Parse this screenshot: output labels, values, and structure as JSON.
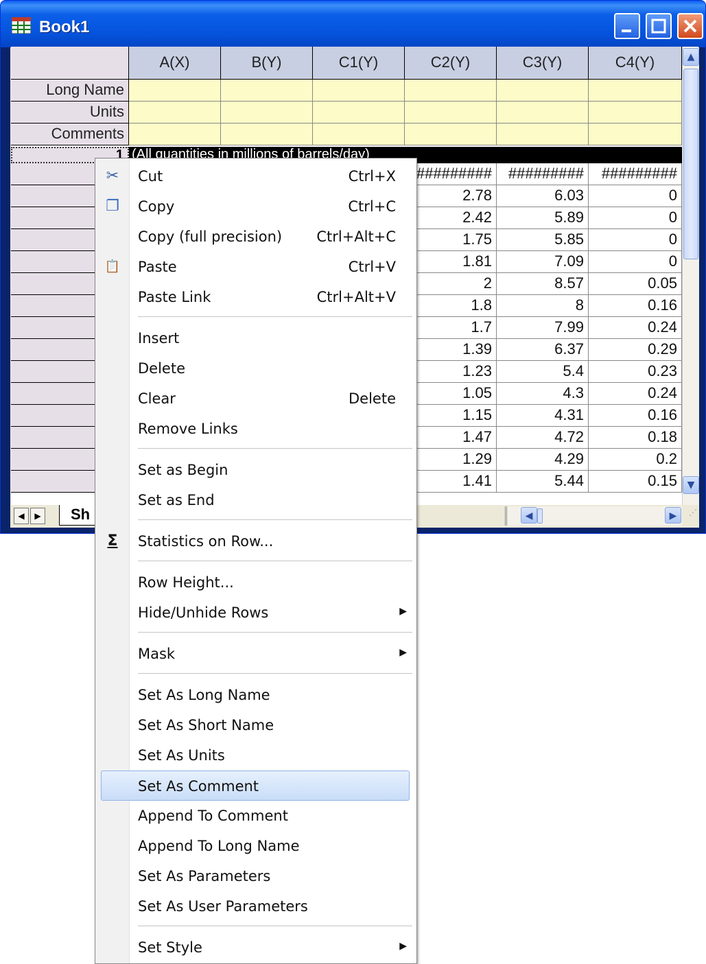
{
  "window": {
    "title": "Book1",
    "colors": {
      "titlebar": "#0553dc",
      "header": "#c8cfe2",
      "meta_row": "#fdfcc8",
      "highlight": "#c9ddf8"
    }
  },
  "grid": {
    "columns": [
      "A(X)",
      "B(Y)",
      "C1(Y)",
      "C2(Y)",
      "C3(Y)",
      "C4(Y)"
    ],
    "meta_rows": [
      "Long Name",
      "Units",
      "Comments"
    ],
    "row1": {
      "number": "1",
      "comment": "(All quantities in millions of barrels/day)"
    },
    "overflow_row": [
      "#########",
      "#########",
      "#########"
    ],
    "data_rows": [
      [
        "2.78",
        "6.03",
        "0"
      ],
      [
        "2.42",
        "5.89",
        "0"
      ],
      [
        "1.75",
        "5.85",
        "0"
      ],
      [
        "1.81",
        "7.09",
        "0"
      ],
      [
        "2",
        "8.57",
        "0.05"
      ],
      [
        "1.8",
        "8",
        "0.16"
      ],
      [
        "1.7",
        "7.99",
        "0.24"
      ],
      [
        "1.39",
        "6.37",
        "0.29"
      ],
      [
        "1.23",
        "5.4",
        "0.23"
      ],
      [
        "1.05",
        "4.3",
        "0.24"
      ],
      [
        "1.15",
        "4.31",
        "0.16"
      ],
      [
        "1.47",
        "4.72",
        "0.18"
      ],
      [
        "1.29",
        "4.29",
        "0.2"
      ],
      [
        "1.41",
        "5.44",
        "0.15"
      ]
    ],
    "sheet_tab": "Sh"
  },
  "menu": {
    "items": [
      {
        "label": "Cut",
        "shortcut": "Ctrl+X",
        "icon": "scissors-icon"
      },
      {
        "label": "Copy",
        "shortcut": "Ctrl+C",
        "icon": "copy-icon"
      },
      {
        "label": "Copy (full precision)",
        "shortcut": "Ctrl+Alt+C"
      },
      {
        "label": "Paste",
        "shortcut": "Ctrl+V",
        "icon": "paste-icon"
      },
      {
        "label": "Paste Link",
        "shortcut": "Ctrl+Alt+V"
      },
      {
        "label": "Insert"
      },
      {
        "label": "Delete"
      },
      {
        "label": "Clear",
        "shortcut": "Delete"
      },
      {
        "label": "Remove Links"
      },
      {
        "label": "Set as Begin"
      },
      {
        "label": "Set as End"
      },
      {
        "label": "Statistics on Row...",
        "icon": "sigma-icon"
      },
      {
        "label": "Row Height..."
      },
      {
        "label": "Hide/Unhide Rows",
        "submenu": true
      },
      {
        "label": "Mask",
        "submenu": true
      },
      {
        "label": "Set As Long Name"
      },
      {
        "label": "Set As Short Name"
      },
      {
        "label": "Set As Units"
      },
      {
        "label": "Set As Comment",
        "highlighted": true
      },
      {
        "label": "Append To Comment"
      },
      {
        "label": "Append To Long Name"
      },
      {
        "label": "Set As Parameters"
      },
      {
        "label": "Set As User Parameters"
      },
      {
        "label": "Set Style",
        "submenu": true
      }
    ]
  }
}
